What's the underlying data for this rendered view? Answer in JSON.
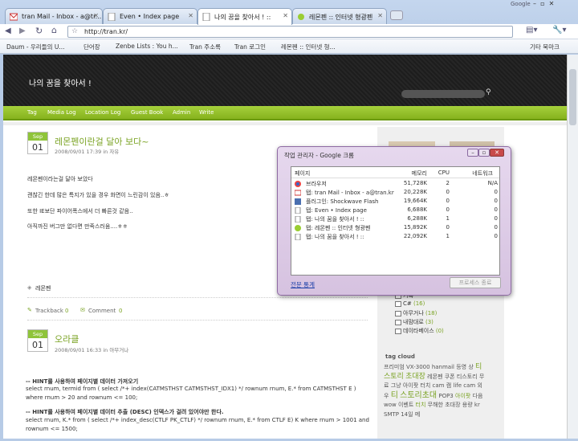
{
  "browser": {
    "brand": "Google",
    "tabs": [
      {
        "label": "tran Mail - Inbox - a@tr...",
        "icon": "gmail-icon"
      },
      {
        "label": "Even • Index page",
        "icon": "page-icon"
      },
      {
        "label": "나의 꿈을 찾아서 ! ::",
        "icon": "page-icon"
      },
      {
        "label": "레몬펜 :: 인터넷 형광펜",
        "icon": "lemonpen-icon"
      }
    ],
    "address": "http://tran.kr/",
    "bookmarks": [
      "Daum - 우리들의 U...",
      "단어장",
      "Zenbe Lists : You h...",
      "Tran 주소록",
      "Tran 로그인",
      "레몬펜 :: 인터넷 형..."
    ],
    "other_bookmarks": "기타 북마크"
  },
  "blog": {
    "title": "나의 꿈을 찾아서 !",
    "nav": [
      "Tag",
      "Media Log",
      "Location Log",
      "Guest Book",
      "Admin",
      "Write"
    ],
    "post1": {
      "month": "Sep",
      "day": "01",
      "title": "레몬펜이란걸 달아 보다~",
      "meta": "2008/09/01 17:39 in 자유",
      "lines": [
        "레몬펜이라는걸 달아 보았다",
        "괜찮긴 한데 많은 특지가 있을 경우 화면이 느린감이 있음..ㅎ",
        "또한 IE보단 파이어폭스에서 더 빠른것 같음..",
        "아직까진 버그만 없다면 만족스러움....ㅎㅎ"
      ],
      "tag": "레몬펜",
      "trackback": "Trackback",
      "trackback_count": "0",
      "comment": "Comment",
      "comment_count": "0"
    },
    "post2": {
      "month": "Sep",
      "day": "01",
      "title": "오라클",
      "meta": "2008/09/01 16:33 in 아무거나",
      "h1": "-- HINT를 사용하여 페이지별 데이터 가져오기",
      "l1": "select rnum, termid from ( select /*+ index(CATMSTHST CATMSTHST_IDX1) */ rownum rnum, E.* from CATMSTHST E )",
      "l2": "where rnum > 20 and rownum <= 100;",
      "h2": "-- HINT를 사용하여 페이지별 데이터 추출 (DESC) 인덱스가 걸려 있어야만 한다.",
      "l3": "select rnum, K.* from ( select /*+ index_desc(CTLF PK_CTLF) */ rownum rnum, E.* from CTLF E) K where rnum > 1001 and",
      "l4": "rownum <= 1500;"
    }
  },
  "sidebar": {
    "cats": [
      {
        "name": "기록",
        "count": ""
      },
      {
        "name": "C#",
        "count": "(16)"
      },
      {
        "name": "아무거나",
        "count": "(18)"
      },
      {
        "name": "내맘대로",
        "count": "(3)"
      },
      {
        "name": "데이타베이스",
        "count": "(0)"
      }
    ],
    "tagcloud_title": "tag cloud",
    "tags": [
      "프리미엄",
      "VX-3000",
      "hanmail",
      "등영",
      "상",
      "티스토리",
      "초대장",
      "레몬펜",
      "쿠폰",
      "티스토리",
      "무료",
      "그냥",
      "아이팟",
      "터치",
      "cam",
      "캠",
      "life cam",
      "외우",
      "티",
      "스토리초대",
      "POP3",
      "아이팟",
      "다음",
      "wow",
      "이벤트",
      "터치",
      "무해한",
      "초대장",
      "용량",
      "kr",
      "SMTP",
      "14일",
      "메"
    ]
  },
  "taskmanager": {
    "title": "작업 관리자 - Google 크롬",
    "columns": [
      "페이지",
      "메모리",
      "CPU",
      "네트워크"
    ],
    "rows": [
      {
        "name": "브라우저",
        "mem": "51,728K",
        "cpu": "2",
        "net": "N/A",
        "icon": "chrome-icon"
      },
      {
        "name": "탭: tran Mail - Inbox - a@tran.kr",
        "mem": "20,228K",
        "cpu": "0",
        "net": "0",
        "icon": "gmail-icon"
      },
      {
        "name": "플러그인: Shockwave Flash",
        "mem": "19,664K",
        "cpu": "0",
        "net": "0",
        "icon": "plugin-icon"
      },
      {
        "name": "탭: Even • Index page",
        "mem": "6,688K",
        "cpu": "0",
        "net": "0",
        "icon": "page-icon"
      },
      {
        "name": "탭: 나의 꿈을 찾아서 ! ::",
        "mem": "6,288K",
        "cpu": "1",
        "net": "0",
        "icon": "page-icon"
      },
      {
        "name": "탭: 레몬펜 :: 인터넷 형광펜",
        "mem": "15,892K",
        "cpu": "0",
        "net": "0",
        "icon": "lemonpen-icon"
      },
      {
        "name": "탭: 나의 꿈을 찾아서 ! ::",
        "mem": "22,092K",
        "cpu": "1",
        "net": "0",
        "icon": "page-icon"
      }
    ],
    "stats_link": "전문 통계",
    "end_process": "프로세스 종료"
  }
}
